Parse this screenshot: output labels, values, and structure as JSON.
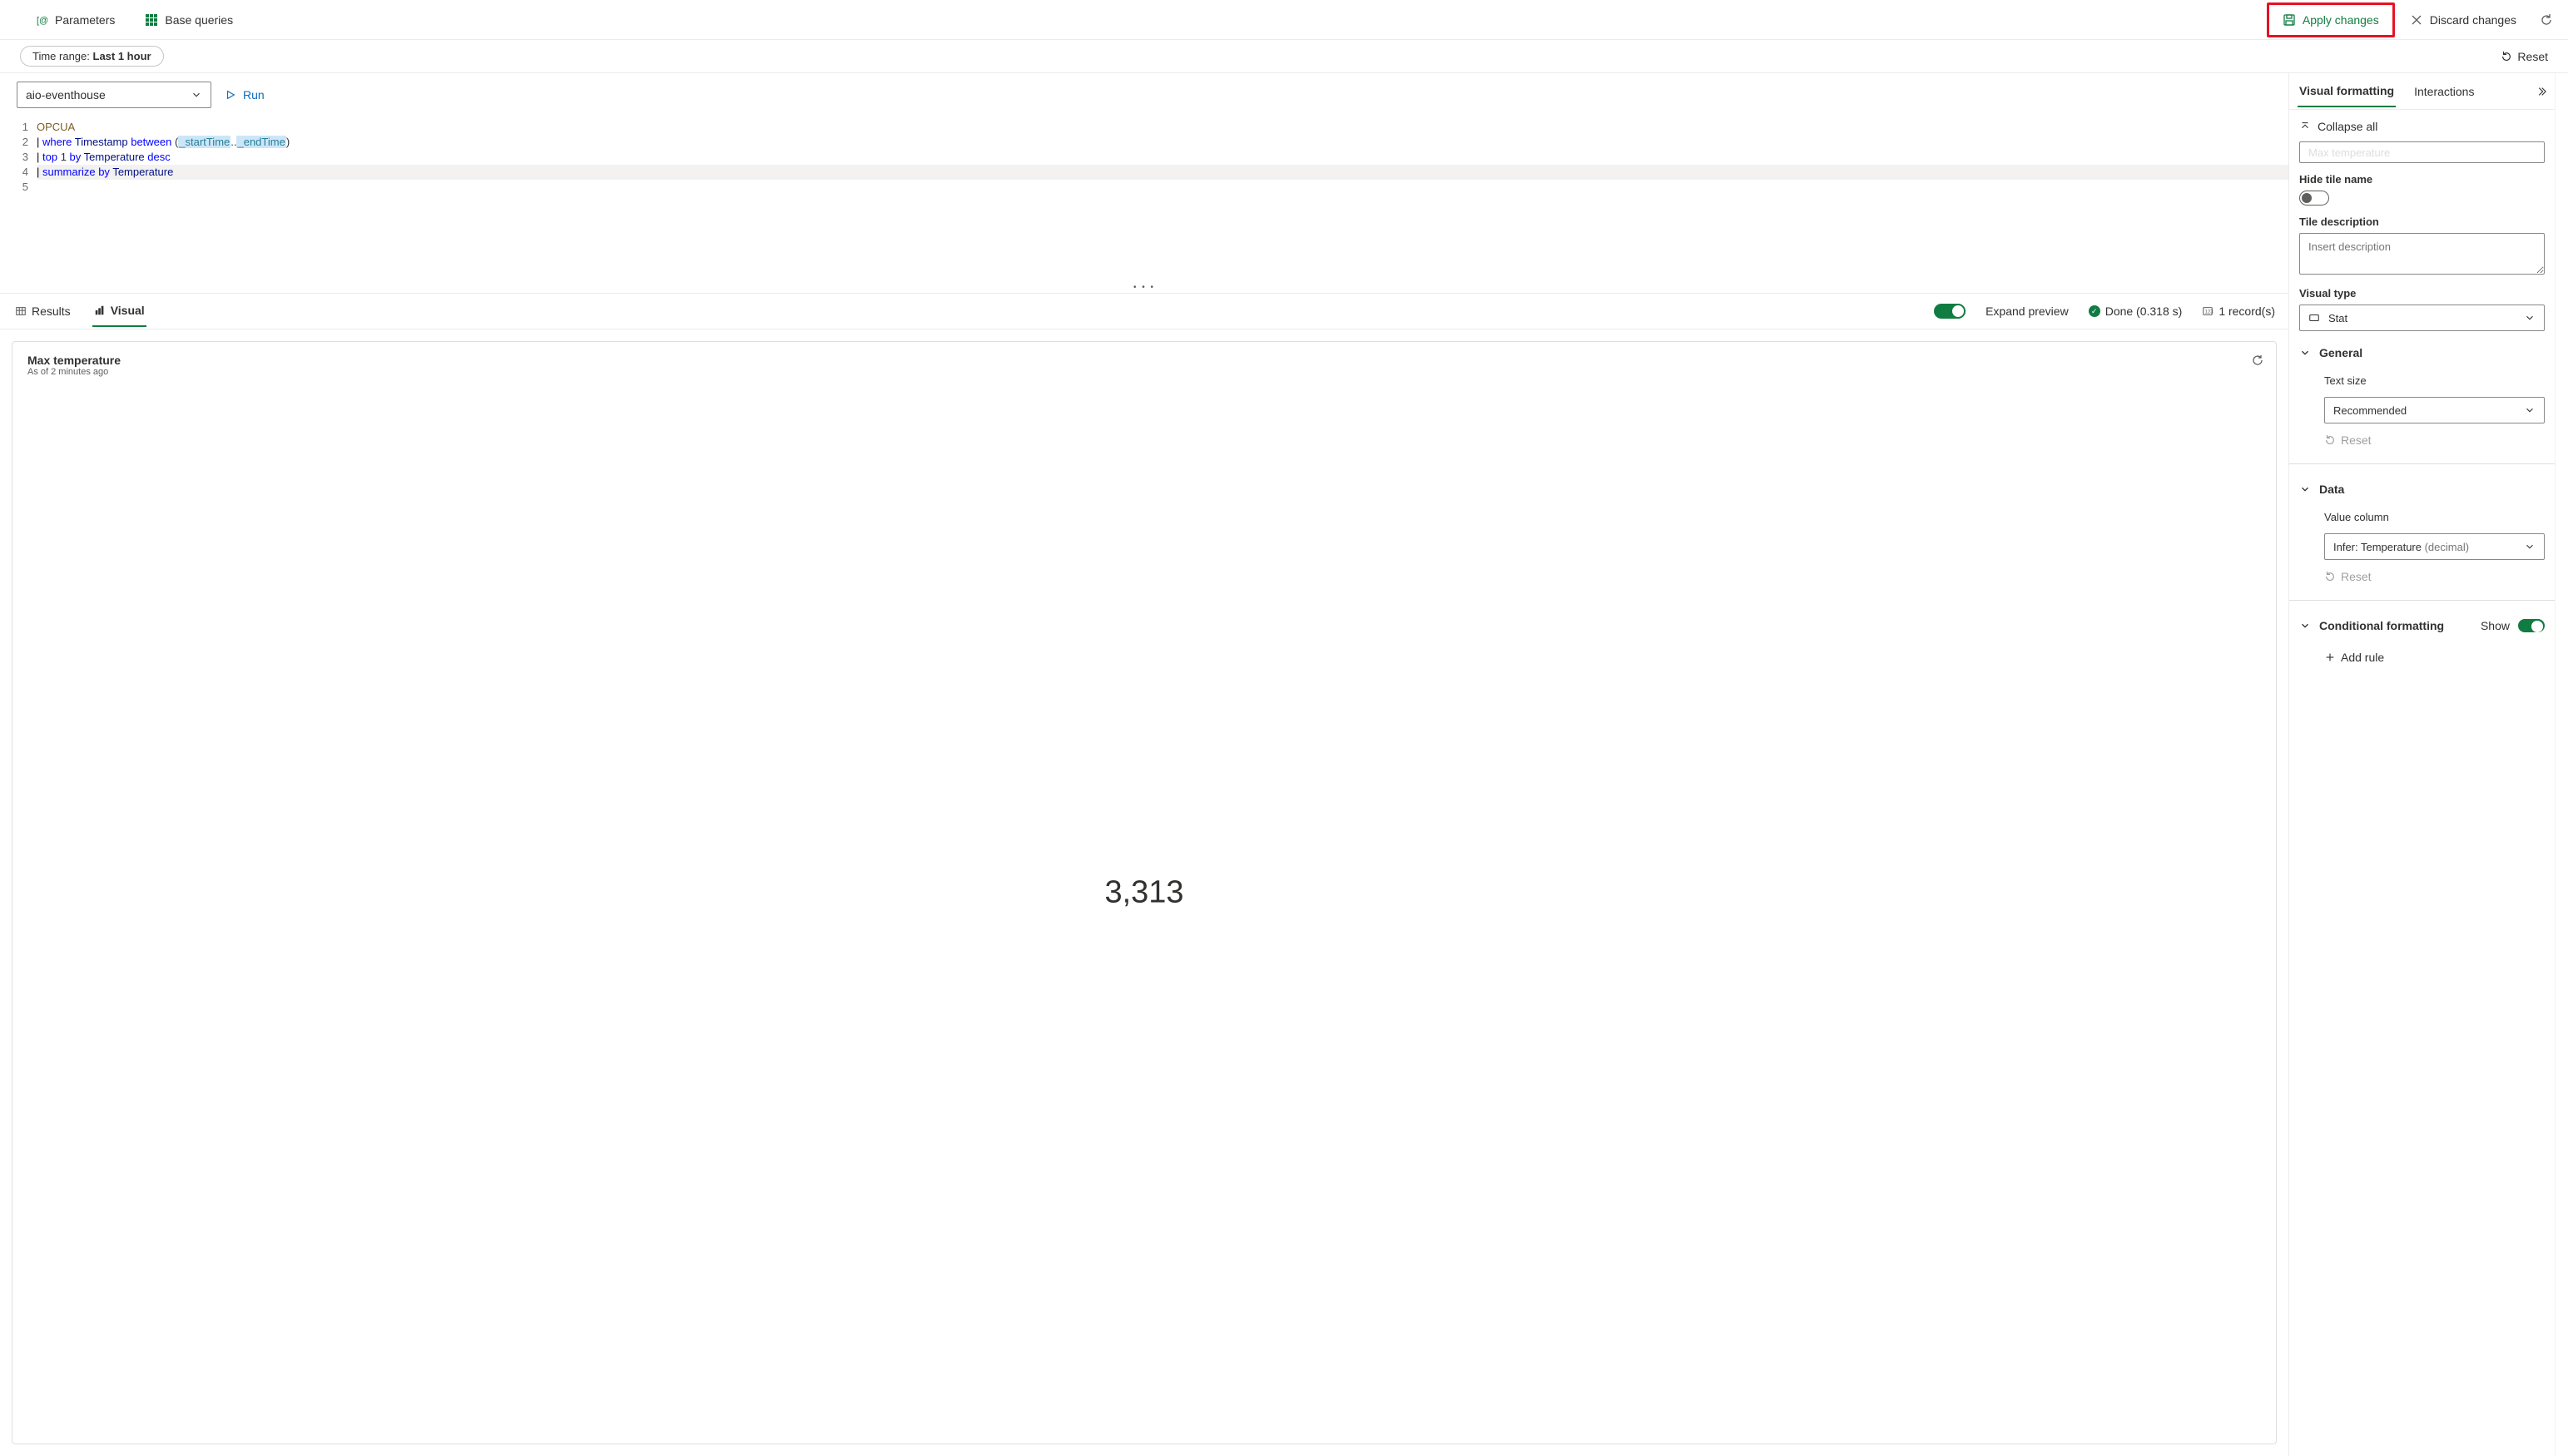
{
  "topbar": {
    "parameters": "Parameters",
    "base_queries": "Base queries",
    "apply": "Apply changes",
    "discard": "Discard changes"
  },
  "timerange": {
    "prefix": "Time range: ",
    "value": "Last 1 hour"
  },
  "reset": "Reset",
  "connection": {
    "value": "aio-eventhouse"
  },
  "run": "Run",
  "code": {
    "l1": "OPCUA",
    "l2_pipe": "| ",
    "l2_where": "where",
    "l2_ts": " Timestamp ",
    "l2_between": "between",
    "l2_open": " (",
    "l2_p1": "_startTime",
    "l2_dots": "..",
    "l2_p2": "_endTime",
    "l2_close": ")",
    "l3_pipe": "| ",
    "l3_top": "top",
    "l3_1": " 1 ",
    "l3_by": "by",
    "l3_col": " Temperature ",
    "l3_desc": "desc",
    "l4_pipe": "| ",
    "l4_sum": "summarize",
    "l4_sp": " ",
    "l4_by": "by",
    "l4_col": " Temperature"
  },
  "result_tabs": {
    "results": "Results",
    "visual": "Visual"
  },
  "resultbar": {
    "expand": "Expand preview",
    "done": "Done (0.318 s)",
    "records": "1 record(s)"
  },
  "card": {
    "title": "Max temperature",
    "sub": "As of 2 minutes ago",
    "value": "3,313"
  },
  "panel": {
    "tab1": "Visual formatting",
    "tab2": "Interactions",
    "collapse_all": "Collapse all",
    "partial_tile_name": "Max temperature",
    "hide_tile": "Hide tile name",
    "tile_desc_label": "Tile description",
    "tile_desc_ph": "Insert description",
    "visual_type_label": "Visual type",
    "visual_type_value": "Stat",
    "general": "General",
    "text_size_label": "Text size",
    "text_size_value": "Recommended",
    "reset_btn": "Reset",
    "data": "Data",
    "value_col_label": "Value column",
    "value_col_prefix": "Infer: Temperature ",
    "value_col_suffix": "(decimal)",
    "cond_fmt": "Conditional formatting",
    "show": "Show",
    "add_rule": "Add rule"
  }
}
